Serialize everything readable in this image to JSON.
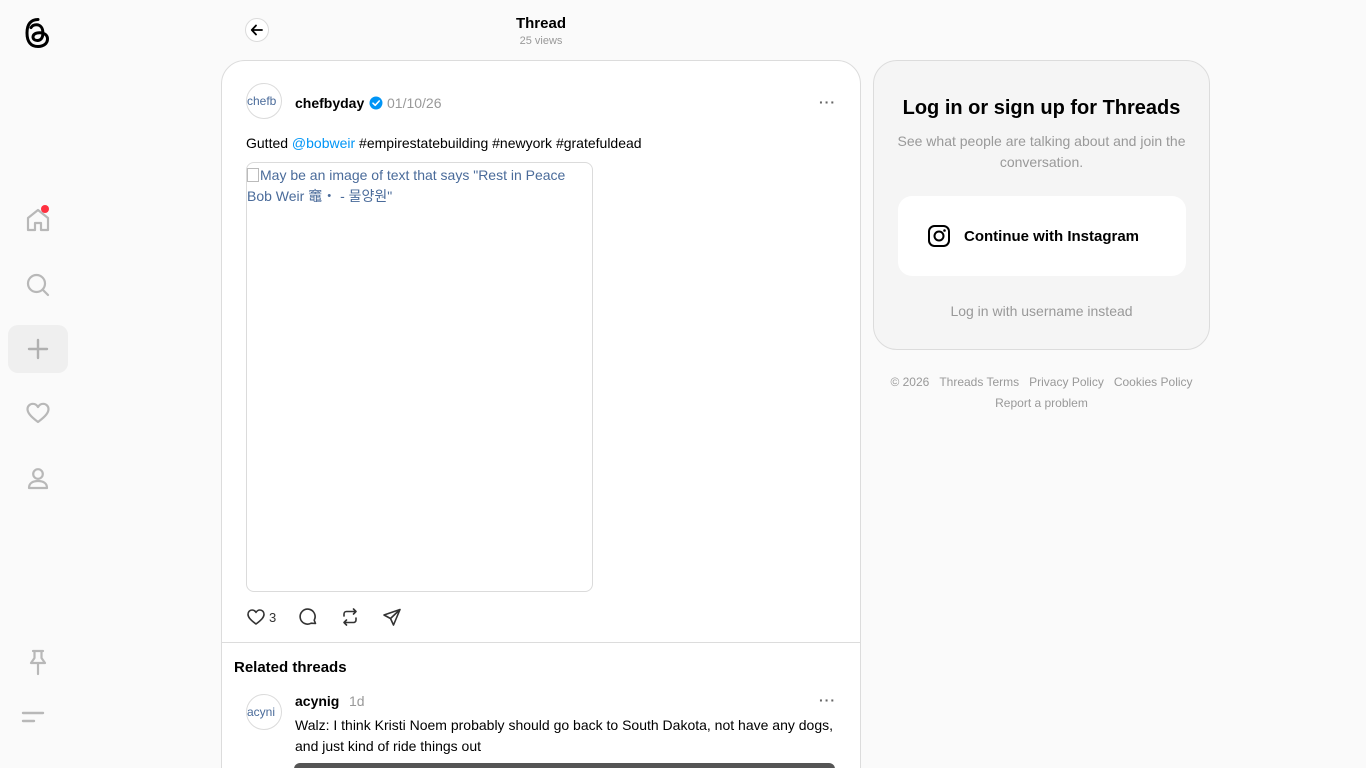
{
  "header": {
    "title": "Thread",
    "views": "25 views"
  },
  "sidebar": {
    "items": [
      {
        "name": "home",
        "icon": "home-icon",
        "has_notification": true
      },
      {
        "name": "search",
        "icon": "search-icon"
      },
      {
        "name": "create",
        "icon": "plus-icon",
        "active": true
      },
      {
        "name": "activity",
        "icon": "heart-icon"
      },
      {
        "name": "profile",
        "icon": "user-icon"
      },
      {
        "name": "pinned",
        "icon": "pin-icon"
      },
      {
        "name": "more",
        "icon": "menu-icon"
      }
    ]
  },
  "post": {
    "avatar_alt": "chefb",
    "username": "chefbyday",
    "verified": true,
    "time": "01/10/26",
    "text_prefix": "Gutted ",
    "mention": "@bobweir",
    "hashtags": " #empirestatebuilding #newyork #gratefuldead",
    "image_alt": "May be an image of text that says \"Rest in Peace Bob Weir 竈・ - 물양원\"",
    "likes": "3",
    "more_label": "···"
  },
  "related": {
    "title": "Related threads",
    "items": [
      {
        "avatar_alt": "acyni",
        "username": "acynig",
        "time": "1d",
        "text": "Walz: I think Kristi Noem probably should go back to South Dakota, not have any dogs, and just kind of ride things out",
        "more_label": "···"
      }
    ]
  },
  "login": {
    "title": "Log in or sign up for Threads",
    "subtitle": "See what people are talking about and join the conversation.",
    "instagram_button": "Continue with Instagram",
    "alt_login": "Log in with username instead"
  },
  "footer": {
    "copyright": "© 2026",
    "links": [
      "Threads Terms",
      "Privacy Policy",
      "Cookies Policy",
      "Report a problem"
    ]
  },
  "colors": {
    "accent": "#0095f6",
    "notification": "#ff3040"
  }
}
